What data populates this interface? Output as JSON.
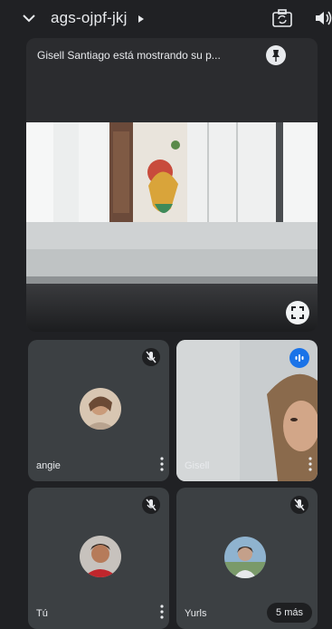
{
  "meeting": {
    "code": "ags-ojpf-jkj"
  },
  "presentation": {
    "caption": "Gisell Santiago está mostrando su p..."
  },
  "participants": [
    {
      "name": "angie",
      "muted": true
    },
    {
      "name": "Gisell",
      "muted": false,
      "speaking": true
    },
    {
      "name": "Tú",
      "muted": true
    },
    {
      "name": "Yurls",
      "muted": true
    }
  ],
  "more_badge": "5 más",
  "colors": {
    "background": "#202124",
    "tile": "#3c4043",
    "speaking": "#1a73e8"
  },
  "icons": [
    "chevron-down-icon",
    "caret-right-icon",
    "camera-flip-icon",
    "speaker-icon",
    "pin-icon",
    "fullscreen-icon",
    "mic-off-icon",
    "more-vert-icon",
    "audio-level-icon"
  ]
}
